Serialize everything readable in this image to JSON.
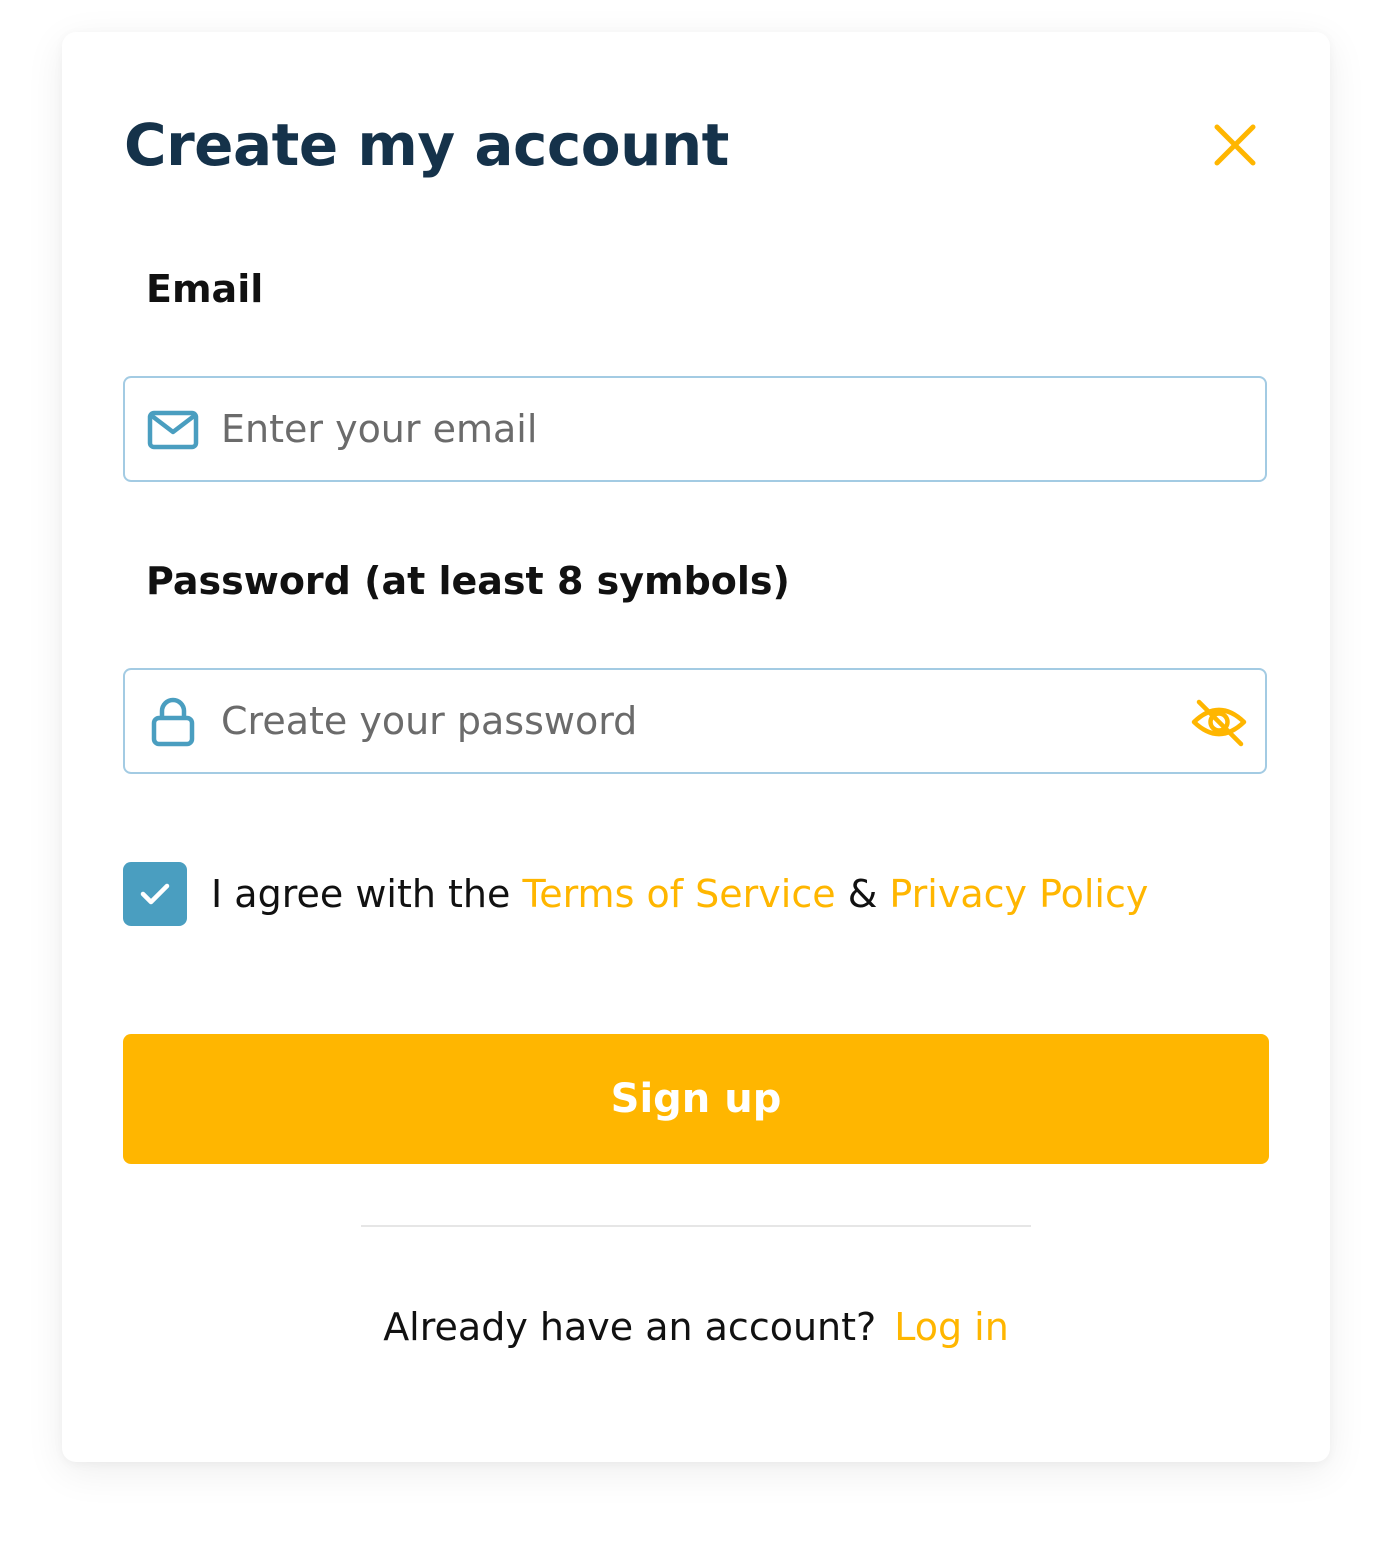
{
  "dialog": {
    "title": "Create my account",
    "close_icon": "close-icon"
  },
  "email": {
    "label": "Email",
    "placeholder": "Enter your email",
    "value": "",
    "icon": "mail-icon"
  },
  "password": {
    "label": "Password (at least 8 symbols)",
    "placeholder": "Create your password",
    "value": "",
    "icon": "lock-icon",
    "toggle_icon": "eye-off-icon"
  },
  "agreement": {
    "checked": true,
    "prefix": "I agree with the ",
    "terms_link": "Terms of Service",
    "separator": " & ",
    "privacy_link": "Privacy Policy"
  },
  "signup_button": {
    "label": "Sign up"
  },
  "footer": {
    "question": "Already have an account?",
    "login_link": "Log in"
  },
  "colors": {
    "accent": "#ffb600",
    "title": "#15324a",
    "checkbox": "#4a9ec0",
    "input_border": "#a3cbe3",
    "icon": "#4a9ec0"
  }
}
